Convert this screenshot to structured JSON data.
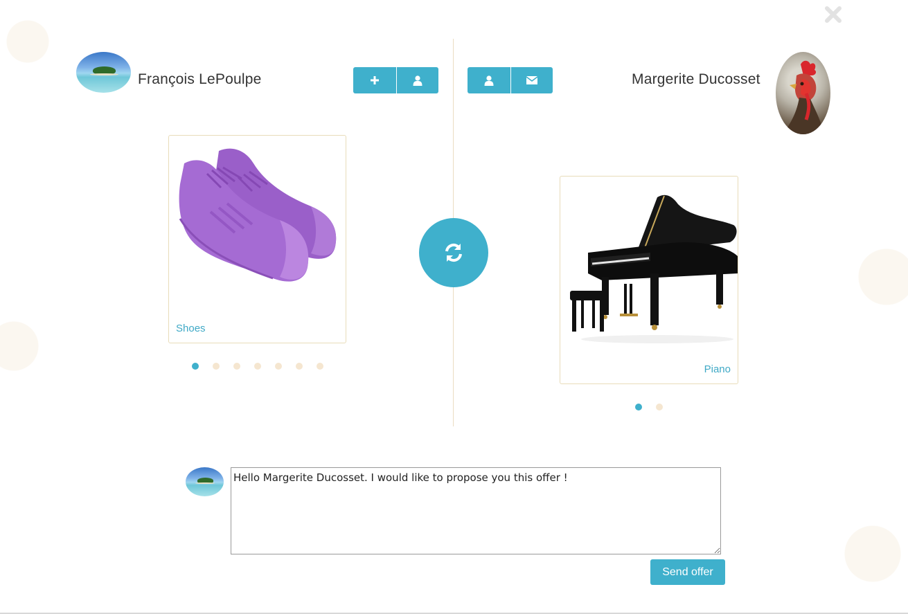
{
  "dialog": {
    "close_icon": "close-icon",
    "swap_icon": "refresh-icon"
  },
  "left_user": {
    "name": "François LePoulpe",
    "avatar": "island-photo",
    "actions": [
      {
        "name": "add-button",
        "icon": "plus-icon"
      },
      {
        "name": "profile-button",
        "icon": "user-icon"
      }
    ],
    "item": {
      "label": "Shoes",
      "image": "purple-sneakers"
    },
    "carousel": {
      "count": 7,
      "active": 0
    }
  },
  "right_user": {
    "name": "Margerite Ducosset",
    "avatar": "rooster-photo",
    "actions": [
      {
        "name": "profile-button",
        "icon": "user-icon"
      },
      {
        "name": "message-button",
        "icon": "envelope-icon"
      }
    ],
    "item": {
      "label": "Piano",
      "image": "grand-piano"
    },
    "carousel": {
      "count": 2,
      "active": 0
    }
  },
  "composer": {
    "message": "Hello Margerite Ducosset. I would like to propose you this offer !",
    "send_label": "Send offer"
  },
  "colors": {
    "accent": "#3fb0cc",
    "divider": "#eadcc2",
    "dot_inactive": "#f5e6d0"
  }
}
